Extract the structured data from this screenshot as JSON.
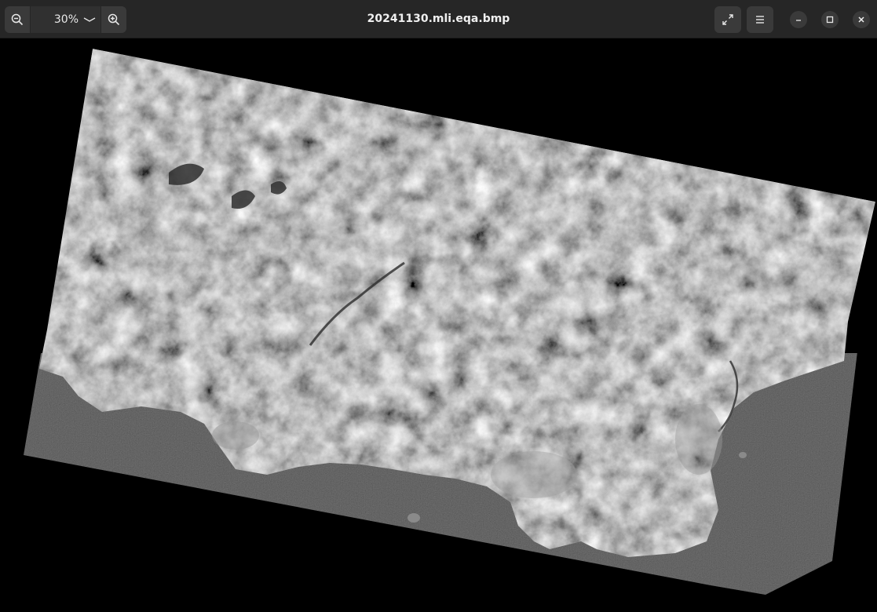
{
  "window": {
    "title": "20241130.mli.eqa.bmp"
  },
  "toolbar": {
    "zoom_level": "30%",
    "zoom_out_icon": "zoom-out-icon",
    "zoom_in_icon": "zoom-in-icon",
    "zoom_dropdown_icon": "chevron-down-icon",
    "fullscreen_icon": "fullscreen-icon",
    "menu_icon": "hamburger-menu-icon"
  },
  "window_controls": {
    "minimize_icon": "minimize-icon",
    "maximize_icon": "maximize-icon",
    "close_icon": "close-icon"
  },
  "colors": {
    "headerbar": "#262626",
    "button": "#3a3a3a",
    "canvas": "#000000",
    "land": "#7a7a7a",
    "sea": "#3c3c3c"
  }
}
